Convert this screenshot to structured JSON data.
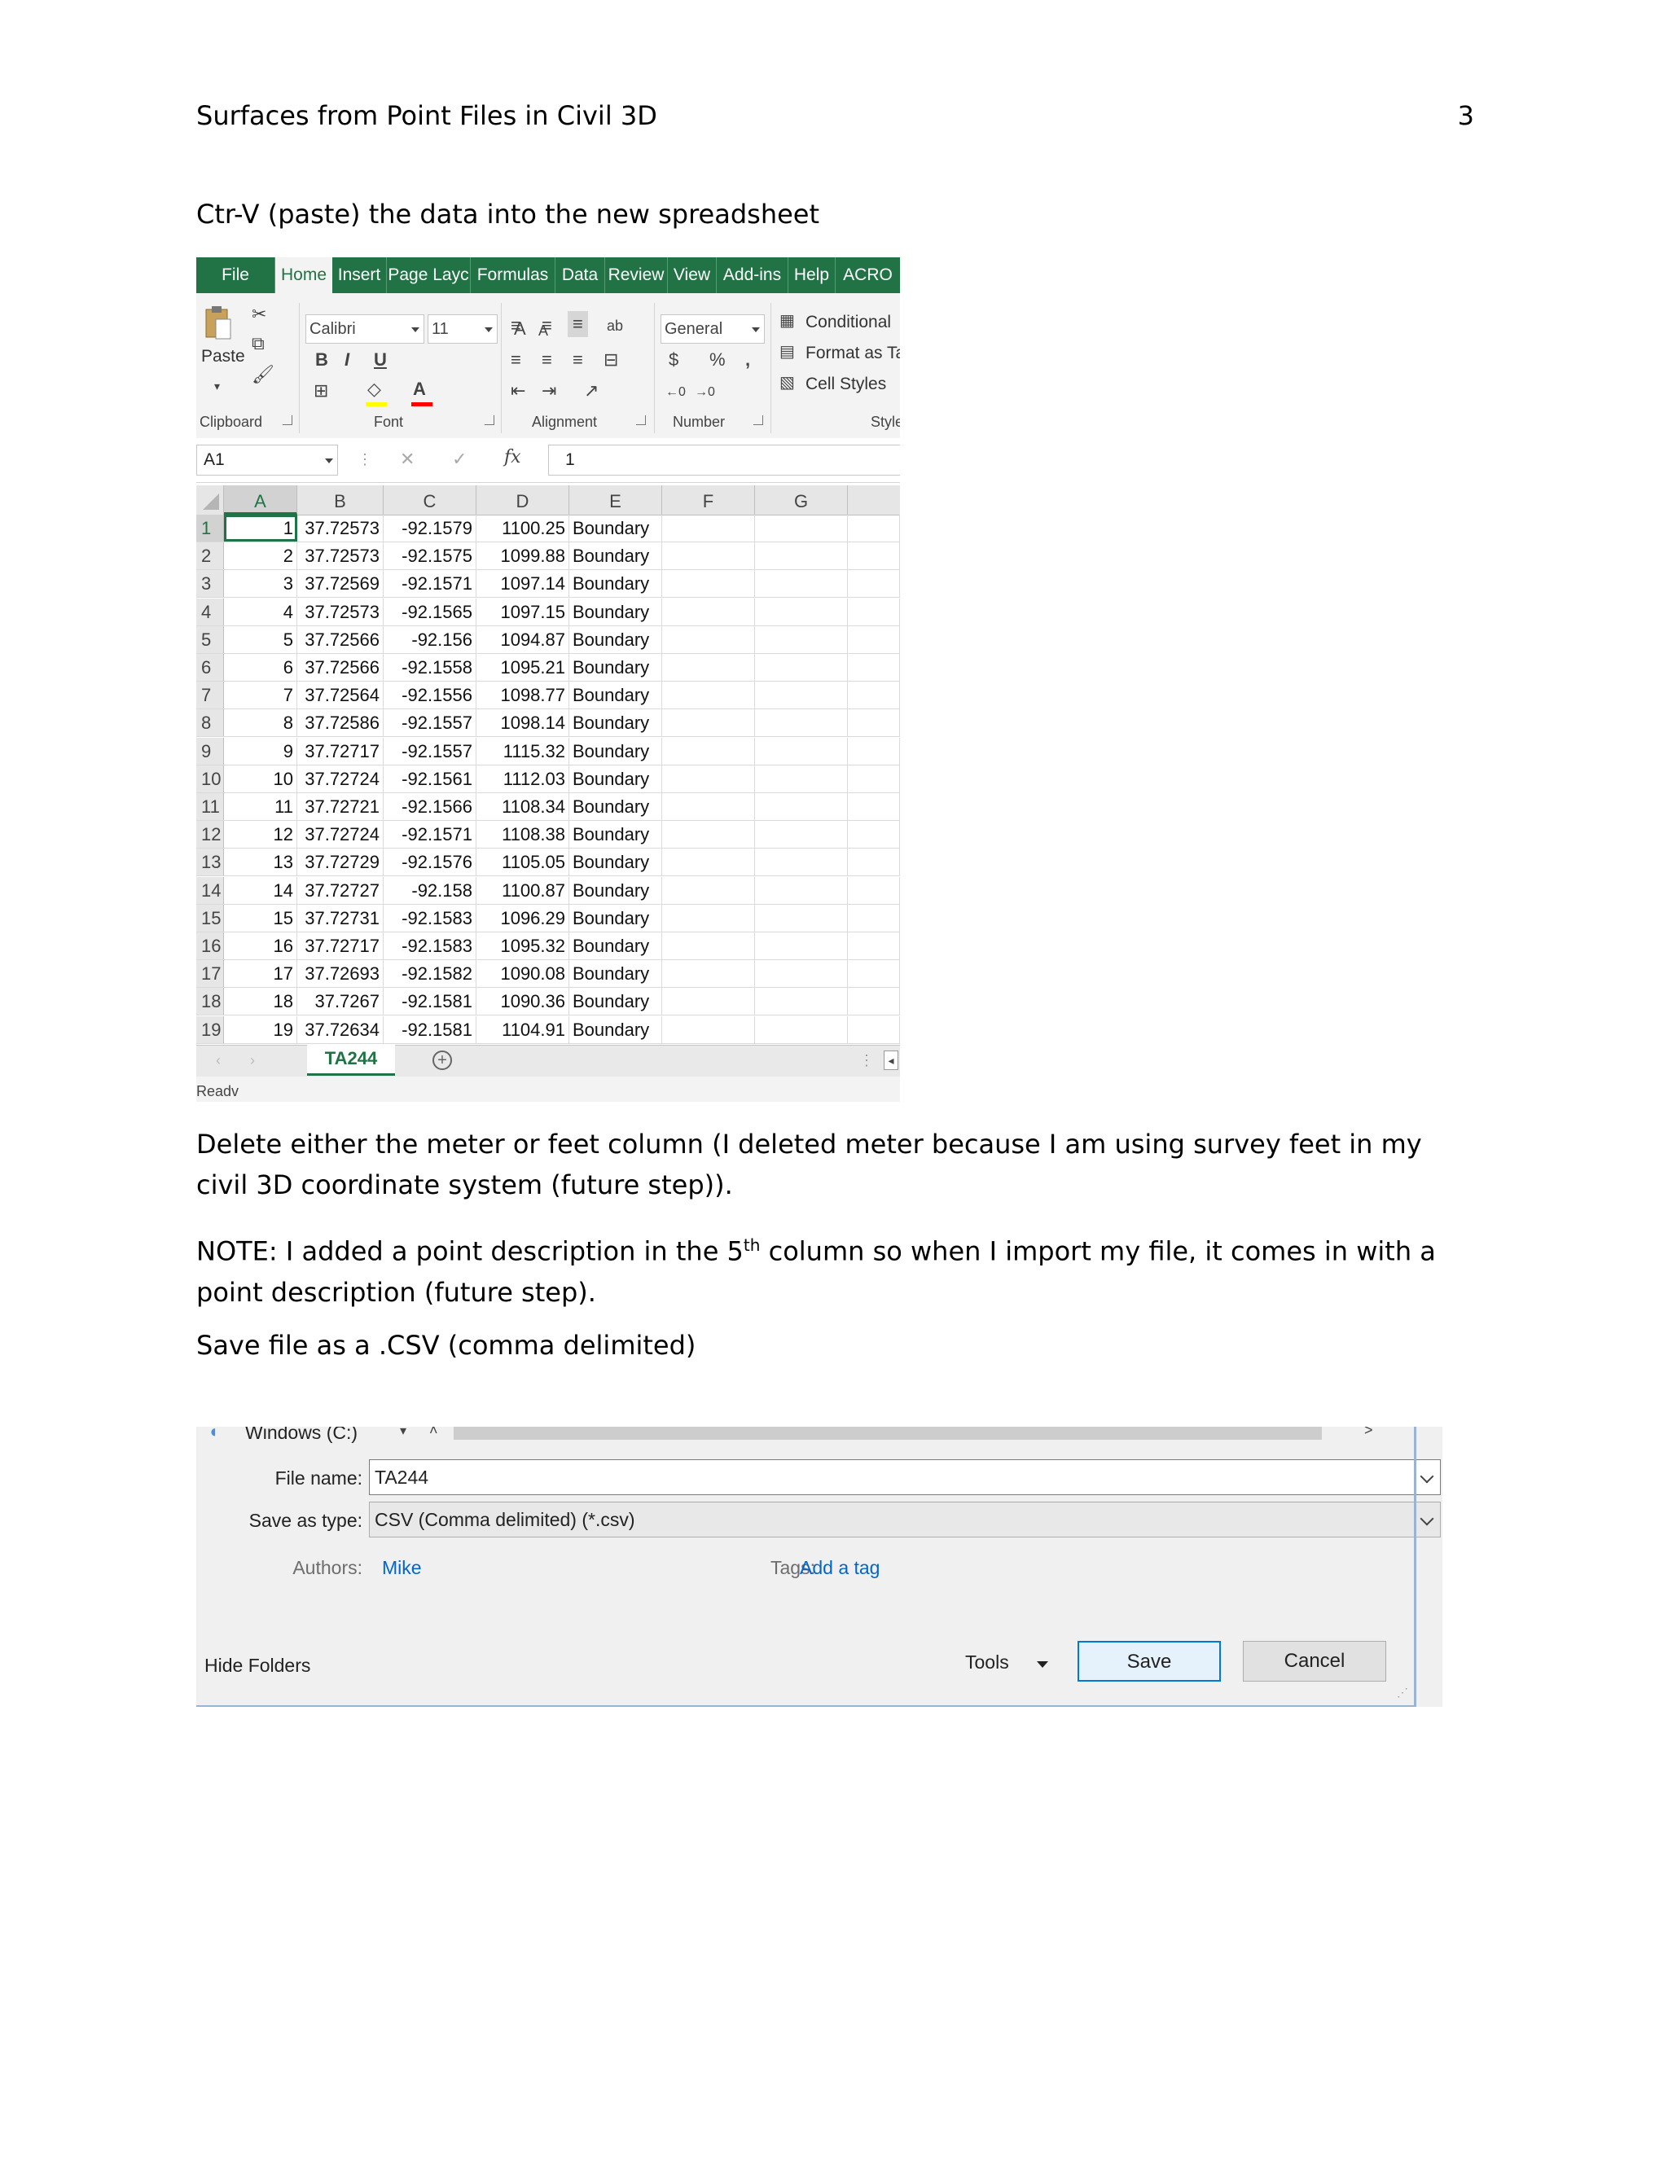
{
  "page": {
    "header_title": "Surfaces from Point Files in Civil 3D",
    "page_number": "3",
    "para1": "Ctr-V (paste) the data into the new spreadsheet",
    "para2": "Delete either the meter or feet column (I deleted meter because I am using survey feet in my civil 3D coordinate system (future step)).",
    "note_prefix": "NOTE: I added a point description in the 5",
    "note_sup": "th",
    "note_suffix": " column so when I import my file, it comes in with a point description (future step).",
    "para3": "Save file as a .CSV (comma delimited)"
  },
  "excel": {
    "accent_color": "#217346",
    "tabs": [
      "File",
      "Home",
      "Insert",
      "Page Layc",
      "Formulas",
      "Data",
      "Review",
      "View",
      "Add-ins",
      "Help",
      "ACRO"
    ],
    "active_tab": "Home",
    "ribbon": {
      "paste_label": "Paste",
      "font_name": "Calibri",
      "font_size": "11",
      "number_format": "General",
      "conditional": "Conditional",
      "format_as": "Format as Ta",
      "cell_styles": "Cell Styles",
      "groups": [
        "Clipboard",
        "Font",
        "Alignment",
        "Number",
        "Style"
      ]
    },
    "name_box": "A1",
    "formula_value": "1",
    "fx_symbol": "fx",
    "columns": [
      "A",
      "B",
      "C",
      "D",
      "E",
      "F",
      "G"
    ],
    "rows": [
      {
        "n": "1",
        "a": "1",
        "b": "37.72573",
        "c": "-92.1579",
        "d": "1100.25",
        "e": "Boundary"
      },
      {
        "n": "2",
        "a": "2",
        "b": "37.72573",
        "c": "-92.1575",
        "d": "1099.88",
        "e": "Boundary"
      },
      {
        "n": "3",
        "a": "3",
        "b": "37.72569",
        "c": "-92.1571",
        "d": "1097.14",
        "e": "Boundary"
      },
      {
        "n": "4",
        "a": "4",
        "b": "37.72573",
        "c": "-92.1565",
        "d": "1097.15",
        "e": "Boundary"
      },
      {
        "n": "5",
        "a": "5",
        "b": "37.72566",
        "c": "-92.156",
        "d": "1094.87",
        "e": "Boundary"
      },
      {
        "n": "6",
        "a": "6",
        "b": "37.72566",
        "c": "-92.1558",
        "d": "1095.21",
        "e": "Boundary"
      },
      {
        "n": "7",
        "a": "7",
        "b": "37.72564",
        "c": "-92.1556",
        "d": "1098.77",
        "e": "Boundary"
      },
      {
        "n": "8",
        "a": "8",
        "b": "37.72586",
        "c": "-92.1557",
        "d": "1098.14",
        "e": "Boundary"
      },
      {
        "n": "9",
        "a": "9",
        "b": "37.72717",
        "c": "-92.1557",
        "d": "1115.32",
        "e": "Boundary"
      },
      {
        "n": "10",
        "a": "10",
        "b": "37.72724",
        "c": "-92.1561",
        "d": "1112.03",
        "e": "Boundary"
      },
      {
        "n": "11",
        "a": "11",
        "b": "37.72721",
        "c": "-92.1566",
        "d": "1108.34",
        "e": "Boundary"
      },
      {
        "n": "12",
        "a": "12",
        "b": "37.72724",
        "c": "-92.1571",
        "d": "1108.38",
        "e": "Boundary"
      },
      {
        "n": "13",
        "a": "13",
        "b": "37.72729",
        "c": "-92.1576",
        "d": "1105.05",
        "e": "Boundary"
      },
      {
        "n": "14",
        "a": "14",
        "b": "37.72727",
        "c": "-92.158",
        "d": "1100.87",
        "e": "Boundary"
      },
      {
        "n": "15",
        "a": "15",
        "b": "37.72731",
        "c": "-92.1583",
        "d": "1096.29",
        "e": "Boundary"
      },
      {
        "n": "16",
        "a": "16",
        "b": "37.72717",
        "c": "-92.1583",
        "d": "1095.32",
        "e": "Boundary"
      },
      {
        "n": "17",
        "a": "17",
        "b": "37.72693",
        "c": "-92.1582",
        "d": "1090.08",
        "e": "Boundary"
      },
      {
        "n": "18",
        "a": "18",
        "b": "37.7267",
        "c": "-92.1581",
        "d": "1090.36",
        "e": "Boundary"
      },
      {
        "n": "19",
        "a": "19",
        "b": "37.72634",
        "c": "-92.1581",
        "d": "1104.91",
        "e": "Boundary"
      }
    ],
    "sheet_tab": "TA244",
    "status": "Readv"
  },
  "dialog": {
    "accent_color": "#0078d7",
    "drive_label": "Windows (C:)",
    "file_name_label": "File name:",
    "file_name_value": "TA244",
    "save_type_label": "Save as type:",
    "save_type_value": "CSV (Comma delimited) (*.csv)",
    "authors_label": "Authors:",
    "authors_value": "Mike",
    "tags_label": "Tags:",
    "tags_value": "Add a tag",
    "hide_folders": "Hide Folders",
    "tools_label": "Tools",
    "save_label": "Save",
    "cancel_label": "Cancel"
  }
}
